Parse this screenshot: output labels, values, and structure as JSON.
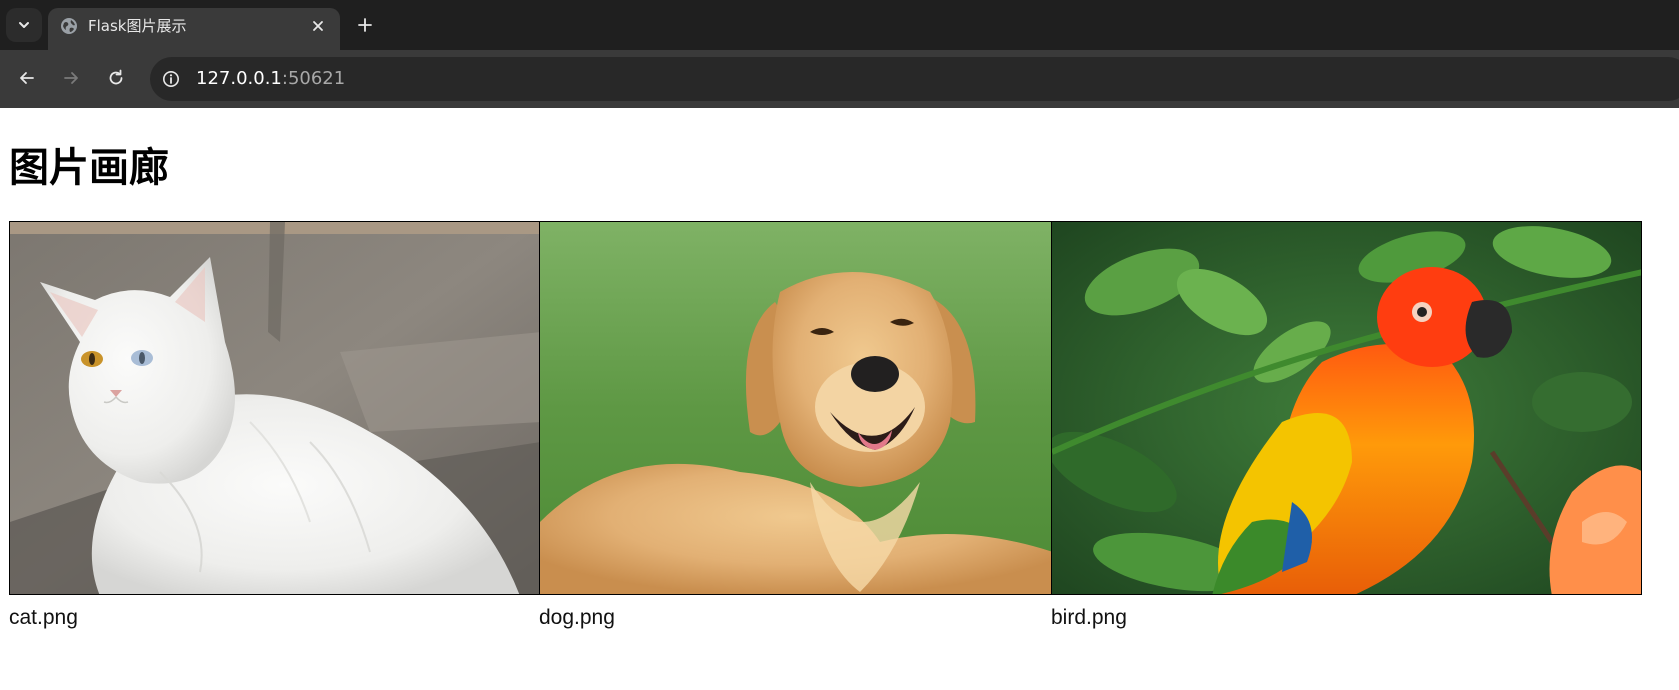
{
  "browser": {
    "tab": {
      "title": "Flask图片展示",
      "favicon": "globe-icon"
    },
    "address_bar": {
      "host": "127.0.0.1",
      "port": ":50621"
    },
    "icons": {
      "tab_search": "chevron-down-icon",
      "close_tab": "close-icon",
      "new_tab": "plus-icon",
      "back": "arrow-left-icon",
      "forward": "arrow-right-icon",
      "reload": "reload-icon",
      "site_info": "info-icon"
    }
  },
  "page": {
    "heading": "图片画廊",
    "images": [
      {
        "caption": "cat.png",
        "subject": "white cat"
      },
      {
        "caption": "dog.png",
        "subject": "golden retriever"
      },
      {
        "caption": "bird.png",
        "subject": "sun conure parrot"
      }
    ]
  },
  "colors": {
    "chrome_dark": "#1f1f1f",
    "chrome_tab": "#3a3a3a",
    "omnibox": "#282828",
    "page_bg": "#ffffff"
  }
}
